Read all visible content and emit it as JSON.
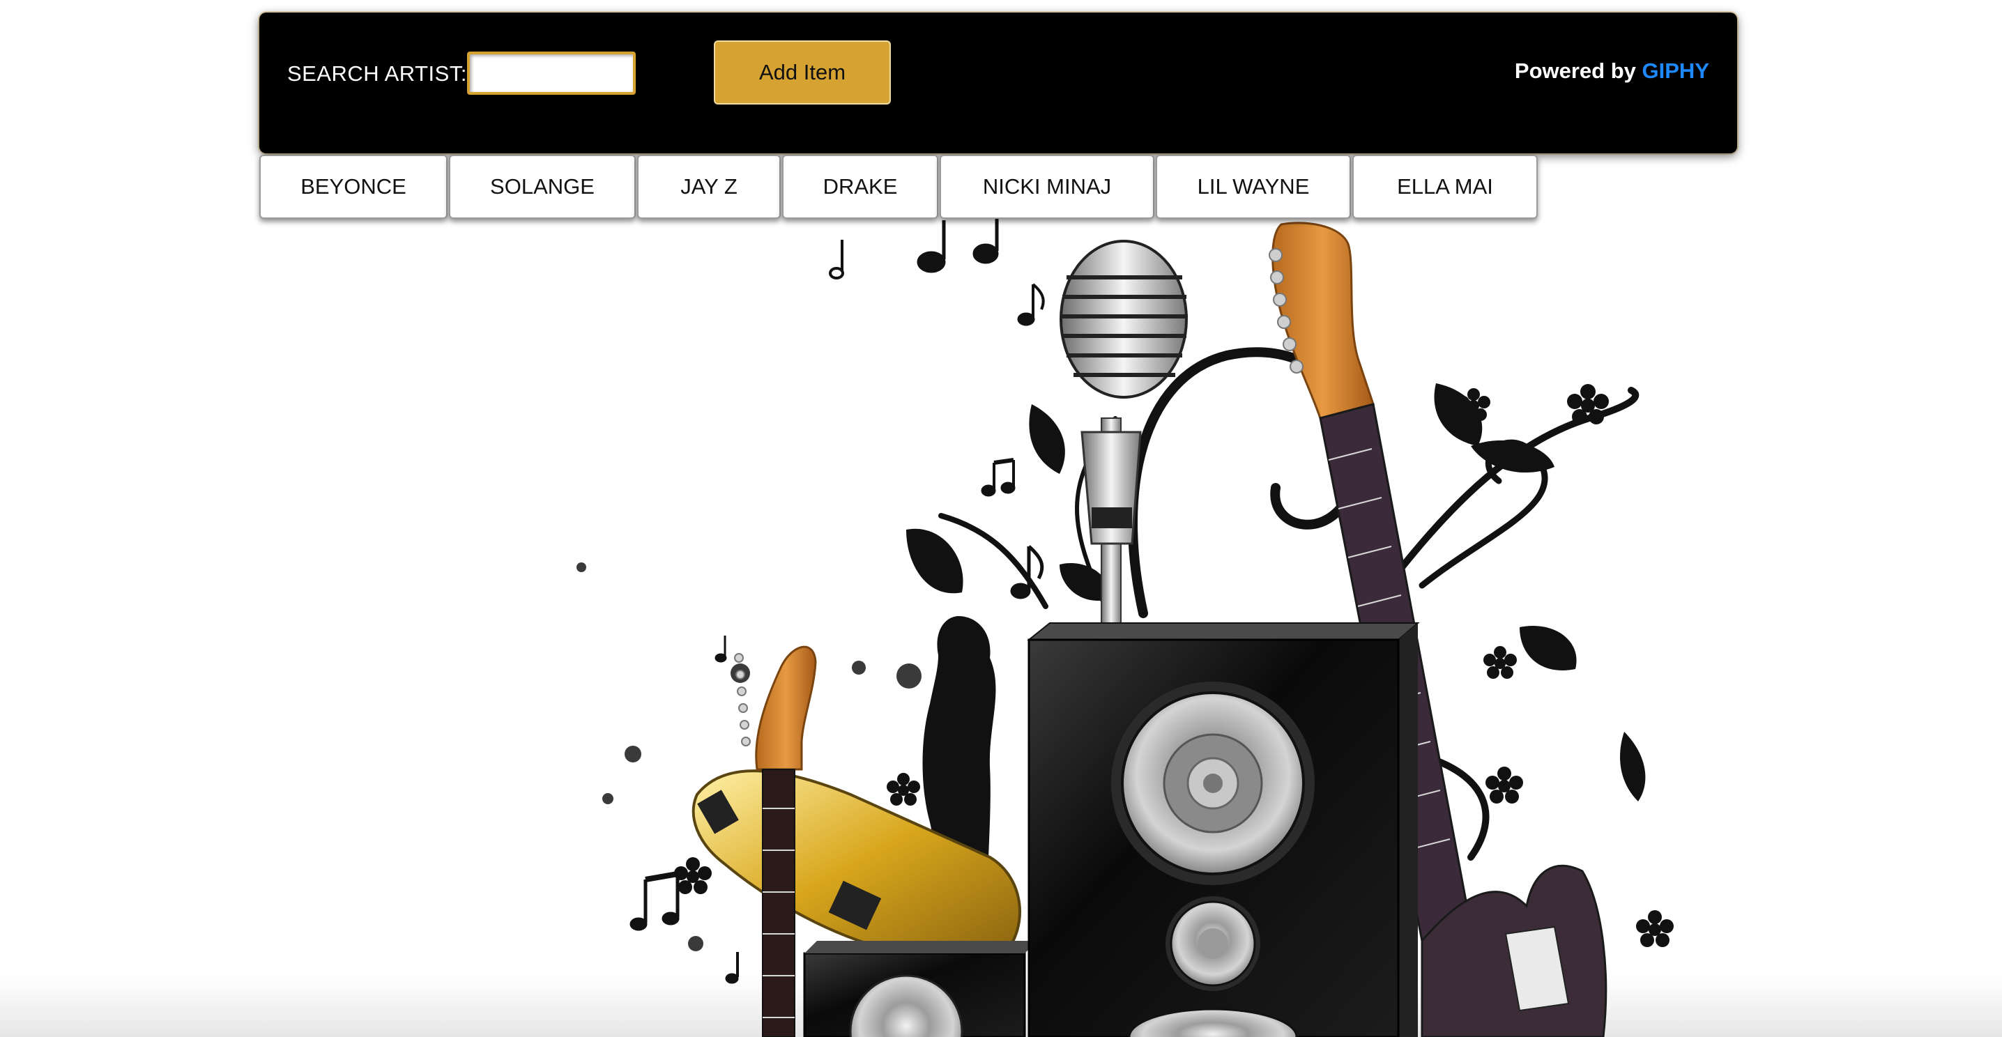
{
  "header": {
    "search_label": "SEARCH ARTIST:",
    "search_value": "",
    "add_button_label": "Add Item",
    "powered_prefix": "Powered by",
    "powered_brand": "GIPHY"
  },
  "artists": [
    "BEYONCE",
    "SOLANGE",
    "JAY Z",
    "DRAKE",
    "NICKI MINAJ",
    "LIL WAYNE",
    "ELLA MAI"
  ],
  "colors": {
    "header_bg": "#000000",
    "accent_gold": "#d6a231",
    "giphy_blue": "#1e88ff",
    "button_bg": "#ffffff"
  },
  "background": {
    "icons": [
      "microphone-icon",
      "speaker-icon",
      "guitar-icon",
      "music-note-icon",
      "flower-icon",
      "silhouette-icon"
    ]
  }
}
